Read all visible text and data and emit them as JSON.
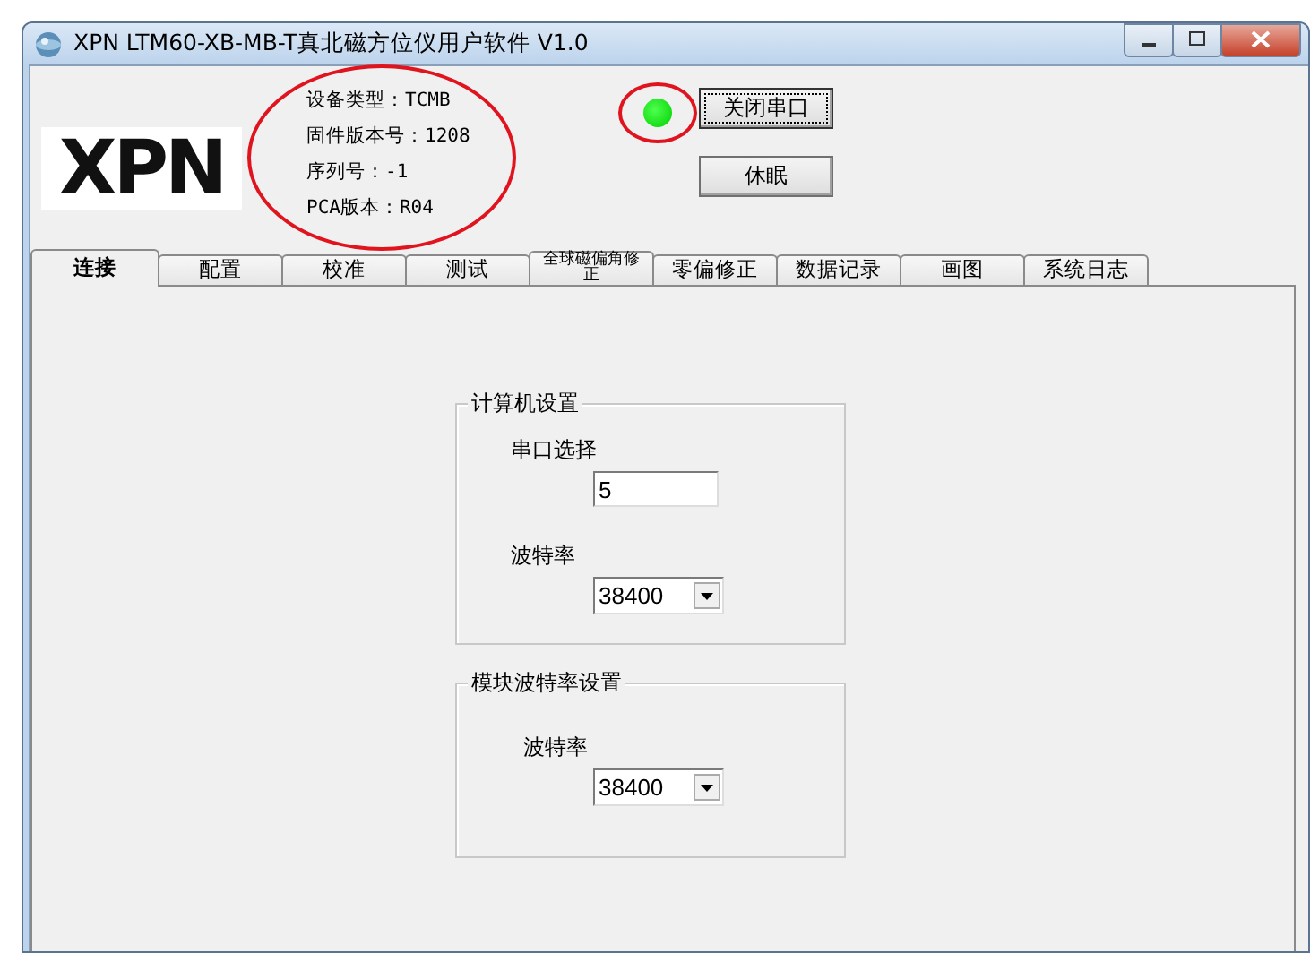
{
  "window": {
    "title": "XPN LTM60-XB-MB-T真北磁方位仪用户软件 V1.0"
  },
  "logo": "XPN",
  "device_info": {
    "circled": true,
    "lines": [
      "设备类型：TCMB",
      "固件版本号：1208",
      "序列号：-1",
      "PCA版本：R04"
    ]
  },
  "status_led": {
    "on": true,
    "circled": true
  },
  "buttons": [
    {
      "label": "关闭串口",
      "focused": true
    },
    {
      "label": "休眠",
      "focused": false
    }
  ],
  "tabs": [
    {
      "label": "连接",
      "selected": true
    },
    {
      "label": "配置",
      "selected": false
    },
    {
      "label": "校准",
      "selected": false
    },
    {
      "label": "测试",
      "selected": false
    },
    {
      "label": "全球磁偏角修正",
      "selected": false
    },
    {
      "label": "零偏修正",
      "selected": false
    },
    {
      "label": "数据记录",
      "selected": false
    },
    {
      "label": "画图",
      "selected": false
    },
    {
      "label": "系统日志",
      "selected": false
    }
  ],
  "groups": [
    {
      "title": "计算机设置",
      "fields": [
        {
          "kind": "text",
          "label": "串口选择",
          "value": "5"
        },
        {
          "kind": "dropdown",
          "label": "波特率",
          "value": "38400"
        }
      ]
    },
    {
      "title": "模块波特率设置",
      "fields": [
        {
          "kind": "dropdown",
          "label": "波特率",
          "value": "38400"
        }
      ]
    }
  ]
}
